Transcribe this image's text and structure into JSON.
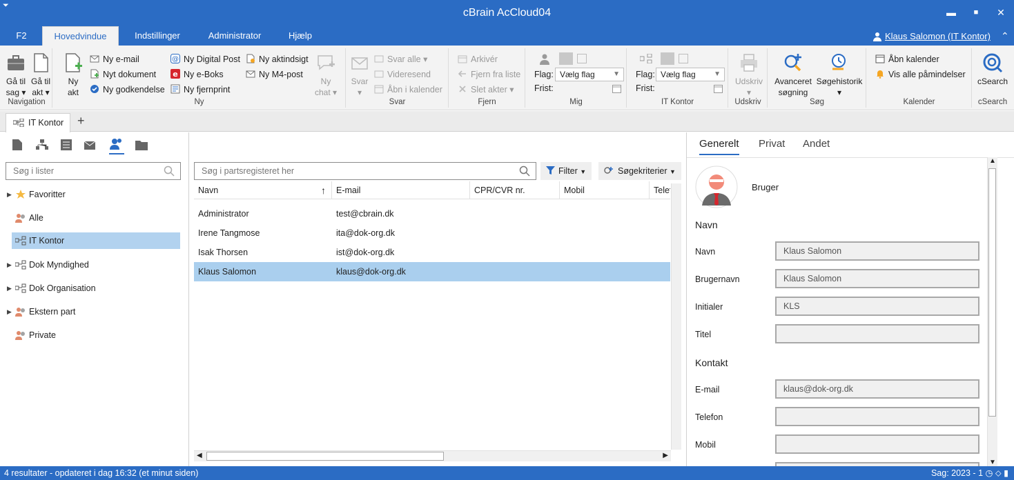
{
  "window": {
    "title": "cBrain AcCloud04",
    "sysmenu": "⏷",
    "min": "▬",
    "max": "■",
    "close": "✕"
  },
  "menu": {
    "tabs": [
      "F2",
      "Hovedvindue",
      "Indstillinger",
      "Administrator",
      "Hjælp"
    ],
    "user": "Klaus Salomon (IT Kontor)",
    "collapse": "⌃"
  },
  "ribbon": {
    "navigation": {
      "label": "Navigation",
      "goto_case": "Gå til sag ▾",
      "goto_case_l1": "Gå til",
      "goto_case_l2": "sag ▾",
      "goto_act_l1": "Gå til",
      "goto_act_l2": "akt ▾"
    },
    "ny": {
      "label": "Ny",
      "new_act_l1": "Ny",
      "new_act_l2": "akt",
      "new_email": "Ny e-mail",
      "new_document": "Nyt dokument",
      "new_approval": "Ny godkendelse",
      "new_digital_post": "Ny Digital Post",
      "new_eboks": "Ny e-Boks",
      "new_remoteprint": "Ny fjernprint",
      "new_access": "Ny aktindsigt",
      "new_m4": "Ny M4-post",
      "new_chat_l1": "Ny",
      "new_chat_l2": "chat ▾"
    },
    "svar": {
      "label": "Svar",
      "reply": "Svar",
      "reply_all": "Svar alle ▾",
      "forward": "Videresend",
      "open_calendar": "Åbn i kalender"
    },
    "fjern": {
      "label": "Fjern",
      "archive": "Arkivér",
      "remove_list": "Fjern fra liste",
      "delete": "Slet akter ▾"
    },
    "mig": {
      "label": "Mig",
      "flag_label": "Flag:",
      "flag_value": "Vælg flag",
      "frist_label": "Frist:"
    },
    "itkontor": {
      "label": "IT Kontor",
      "flag_label": "Flag:",
      "flag_value": "Vælg flag",
      "frist_label": "Frist:"
    },
    "udskriv": {
      "label": "Udskriv",
      "print": "Udskriv"
    },
    "sog": {
      "label": "Søg",
      "advanced_l1": "Avanceret",
      "advanced_l2": "søgning",
      "history": "Søgehistorik"
    },
    "kalender": {
      "label": "Kalender",
      "open": "Åbn kalender",
      "reminders": "Vis alle påmindelser"
    },
    "csearch": {
      "label": "cSearch",
      "button": "cSearch"
    }
  },
  "doctabs": {
    "active": "IT Kontor",
    "add": "+"
  },
  "left": {
    "search_placeholder": "Søg i lister",
    "tree": [
      {
        "label": "Favoritter",
        "expander": "▶"
      },
      {
        "label": "Alle",
        "expander": ""
      },
      {
        "label": "IT Kontor",
        "expander": ""
      },
      {
        "label": "Dok Myndighed",
        "expander": "▶"
      },
      {
        "label": "Dok Organisation",
        "expander": "▶"
      },
      {
        "label": "Ekstern part",
        "expander": "▶"
      },
      {
        "label": "Private",
        "expander": ""
      }
    ]
  },
  "middle": {
    "search_placeholder": "Søg i partsregisteret her",
    "filter": "Filter",
    "criteria": "Søgekriterier",
    "columns": [
      "Navn",
      "E-mail",
      "CPR/CVR nr.",
      "Mobil",
      "Telef"
    ],
    "sort_arrow": "↑",
    "rows": [
      {
        "name": "Administrator",
        "email": "test@cbrain.dk"
      },
      {
        "name": "Irene Tangmose",
        "email": "ita@dok-org.dk"
      },
      {
        "name": "Isak Thorsen",
        "email": "ist@dok-org.dk"
      },
      {
        "name": "Klaus Salomon",
        "email": "klaus@dok-org.dk"
      }
    ]
  },
  "right": {
    "tabs": [
      "Generelt",
      "Privat",
      "Andet"
    ],
    "role": "Bruger",
    "section_name": "Navn",
    "section_contact": "Kontakt",
    "fields": {
      "navn_label": "Navn",
      "navn_value": "Klaus Salomon",
      "brugernavn_label": "Brugernavn",
      "brugernavn_value": "Klaus Salomon",
      "initialer_label": "Initialer",
      "initialer_value": "KLS",
      "titel_label": "Titel",
      "titel_value": "",
      "email_label": "E-mail",
      "email_value": "klaus@dok-org.dk",
      "telefon_label": "Telefon",
      "telefon_value": "",
      "mobil_label": "Mobil",
      "mobil_value": ""
    }
  },
  "status": {
    "left": "4 resultater - opdateret i dag 16:32 (et minut siden)",
    "right": "Sag: 2023 - 1"
  },
  "colors": {
    "accent": "#2b6cc4",
    "selection": "#aacfee"
  }
}
